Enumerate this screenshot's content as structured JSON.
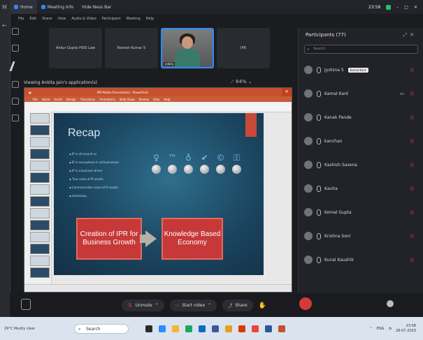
{
  "window": {
    "tabs": [
      "Home",
      "Meeting Info",
      "Hide Ness Bar"
    ],
    "time": "23:58"
  },
  "menu": [
    "File",
    "Edit",
    "Share",
    "View",
    "Audio & Video",
    "Participant",
    "Meeting",
    "Help"
  ],
  "gallery": [
    {
      "label": "Ankur Gupta HOD Law",
      "type": "name"
    },
    {
      "label": "Naresh Kumar S",
      "type": "name"
    },
    {
      "label": "ankita",
      "type": "video"
    },
    {
      "label": "IPR",
      "type": "name"
    }
  ],
  "share": {
    "viewing_label": "Viewing Ankita Jain's application(s)",
    "view_options": "⟋ 64% ⌄"
  },
  "ppt": {
    "title": "IPR Mobile Presentation · PowerPoint",
    "ribbon_tabs": [
      "File",
      "Home",
      "Insert",
      "Design",
      "Transitions",
      "Animations",
      "Slide Show",
      "Review",
      "View",
      "Help"
    ]
  },
  "slide": {
    "title": "Recap",
    "bullets": [
      "IP is all around us",
      "IP is everywhere in all businesses",
      "IP is a business driver",
      "True value of IP assets",
      "Commercialize value of IP assets",
      "Unlocking..."
    ],
    "box_left": "Creation of IPR for Business Growth",
    "box_right": "Knowledge Based Economy"
  },
  "participants": {
    "header": "Participants (77)",
    "search_placeholder": "Search",
    "tooltip": "Kamal Kant",
    "list": [
      {
        "name": "Jyotsna S",
        "muted": true
      },
      {
        "name": "Kamal Kant",
        "muted": true
      },
      {
        "name": "Kanak Pande",
        "muted": true
      },
      {
        "name": "kanchan",
        "muted": true
      },
      {
        "name": "Kashish Saxena",
        "muted": true
      },
      {
        "name": "Kavita",
        "muted": true
      },
      {
        "name": "Komal Gupta",
        "muted": true
      },
      {
        "name": "Krishna Soni",
        "muted": true
      },
      {
        "name": "Kunal Kaushik",
        "muted": true
      }
    ]
  },
  "controls": {
    "unmute": "Unmute",
    "start_video": "Start video",
    "share": "Share"
  },
  "taskbar": {
    "weather": "29°C Mostly clear",
    "search": "Search",
    "clock_time": "23:58",
    "clock_date": "28-07-2023",
    "lang": "ENG"
  },
  "colors": {
    "accent": "#2d8cff",
    "ppt_orange": "#c5522d",
    "slide_box_red": "#c73838",
    "muted_red": "#e0433e"
  }
}
